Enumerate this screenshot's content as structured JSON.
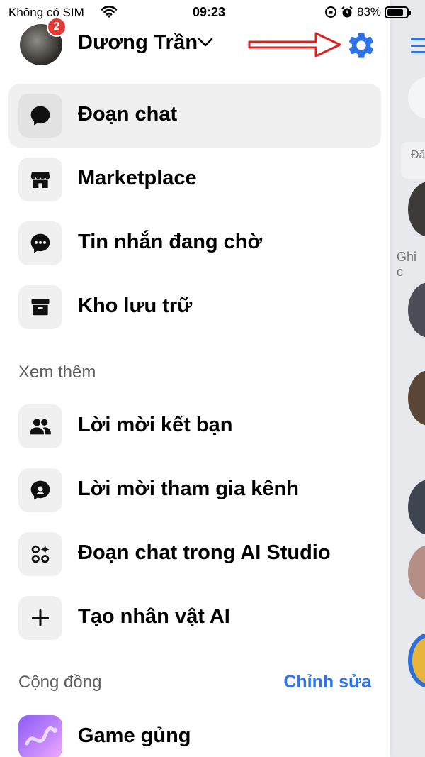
{
  "status_bar": {
    "carrier": "Không có SIM",
    "time": "09:23",
    "battery": "83%"
  },
  "header": {
    "profile_name": "Dương Trần",
    "notification_count": "2"
  },
  "menu": {
    "items": [
      {
        "label": "Đoạn chat",
        "icon": "chat-bubble-icon",
        "active": true
      },
      {
        "label": "Marketplace",
        "icon": "storefront-icon"
      },
      {
        "label": "Tin nhắn đang chờ",
        "icon": "message-dots-icon"
      },
      {
        "label": "Kho lưu trữ",
        "icon": "archive-box-icon"
      }
    ]
  },
  "see_more": {
    "title": "Xem thêm",
    "items": [
      {
        "label": "Lời mời kết bạn",
        "icon": "people-icon"
      },
      {
        "label": "Lời mời tham gia kênh",
        "icon": "channel-chat-icon"
      },
      {
        "label": "Đoạn chat trong AI Studio",
        "icon": "ai-studio-icon"
      },
      {
        "label": "Tạo nhân vật AI",
        "icon": "plus-icon"
      }
    ]
  },
  "community": {
    "title": "Cộng đồng",
    "edit_label": "Chỉnh sửa",
    "items": [
      {
        "label": "Game gủng",
        "icon": "community-avatar"
      }
    ]
  },
  "background": {
    "chip_text": "Đă",
    "label_text": "Ghi c"
  },
  "colors": {
    "accent": "#2f74e6",
    "badge": "#e53935",
    "annotation_arrow": "#e02020",
    "active_row": "#f0f0f0"
  }
}
